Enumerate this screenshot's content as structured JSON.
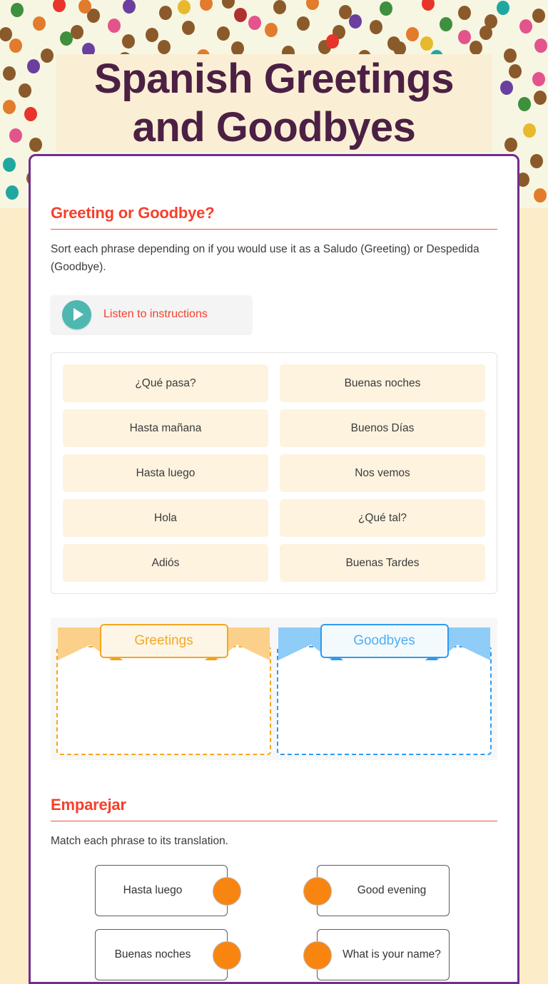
{
  "page": {
    "title_line_1": "Spanish Greetings",
    "title_line_2": "and Goodbyes"
  },
  "colors": {
    "title_text": "#4C2044",
    "banner_bg": "#FAEFD5",
    "card_border": "#702D8F",
    "heading_red": "#F5402C",
    "play_teal": "#4EB8B0",
    "greetings_orange": "#F5A623",
    "goodbyes_blue": "#2E9BF0",
    "match_dot_orange": "#F98511",
    "tile_cream": "#FDF3DF",
    "page_bg": "#FCECC8",
    "confetti_bg": "#F7F6E2"
  },
  "sort_section": {
    "heading": "Greeting or Goodbye?",
    "description": "Sort each phrase depending on if you would use it as a Saludo (Greeting) or Despedida (Goodbye).",
    "audio_button_label": "Listen to instructions",
    "phrases": [
      "¿Qué pasa?",
      "Buenas noches",
      "Hasta mañana",
      "Buenos Días",
      "Hasta luego",
      "Nos vemos",
      "Hola",
      "¿Qué tal?",
      "Adiós",
      "Buenas Tardes"
    ],
    "drop_zones": [
      {
        "label": "Greetings",
        "color": "#F5A623"
      },
      {
        "label": "Goodbyes",
        "color": "#2E9BF0"
      }
    ]
  },
  "match_section": {
    "heading": "Emparejar",
    "description": "Match each phrase to its translation.",
    "left_items": [
      "Hasta luego",
      "Buenas noches"
    ],
    "right_items": [
      "Good evening",
      "What is your name?"
    ]
  }
}
